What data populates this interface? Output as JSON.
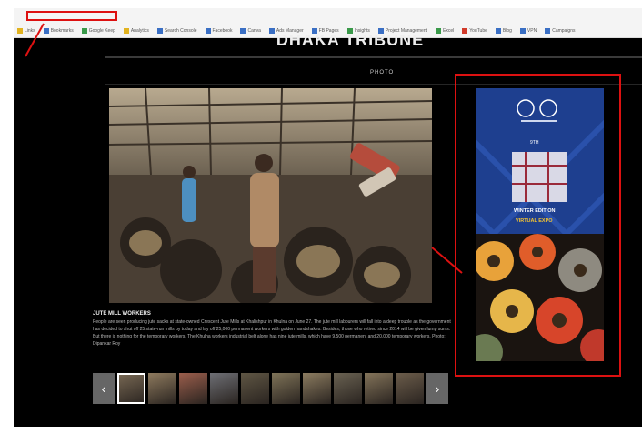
{
  "browser": {
    "bookmarks": [
      {
        "icon": "folder-icon",
        "label": "Links",
        "color": "y"
      },
      {
        "icon": "bookmark-icon",
        "label": "Bookmarks",
        "color": ""
      },
      {
        "icon": "bookmark-icon",
        "label": "Google Keep",
        "color": "g"
      },
      {
        "icon": "bookmark-icon",
        "label": "Analytics",
        "color": "y"
      },
      {
        "icon": "bookmark-icon",
        "label": "Search Console",
        "color": ""
      },
      {
        "icon": "bookmark-icon",
        "label": "Facebook",
        "color": ""
      },
      {
        "icon": "bookmark-icon",
        "label": "Canva",
        "color": ""
      },
      {
        "icon": "bookmark-icon",
        "label": "Ads Manager",
        "color": ""
      },
      {
        "icon": "bookmark-icon",
        "label": "FB Pages",
        "color": ""
      },
      {
        "icon": "bookmark-icon",
        "label": "Insights",
        "color": "g"
      },
      {
        "icon": "bookmark-icon",
        "label": "Project Management",
        "color": ""
      },
      {
        "icon": "bookmark-icon",
        "label": "Excel",
        "color": "g"
      },
      {
        "icon": "bookmark-icon",
        "label": "YouTube",
        "color": "r"
      },
      {
        "icon": "bookmark-icon",
        "label": "Blog",
        "color": ""
      },
      {
        "icon": "bookmark-icon",
        "label": "VPN",
        "color": ""
      },
      {
        "icon": "bookmark-icon",
        "label": "Campaigns",
        "color": ""
      }
    ]
  },
  "site": {
    "title": "DHAKA TRIBUNE",
    "section": "PHOTO"
  },
  "photo": {
    "caption_title": "JUTE MILL WORKERS",
    "caption_text": "People are seen producing jute sacks at state-owned Crescent Jute Mills at Khalishpur in Khulna on June 27. The jute mill labourers will fall into a deep trouble as the government has decided to shut off 25 state-run mills by today and lay off 25,000 permanent workers with golden handshakes. Besides, those who retired since 2014 will be given lump sums. But there is nothing for the temporary workers. The Khulna workers industrial belt alone has nine jute mills, which have 9,500 permanent and 20,000 temporary workers. Photo: Dipankar Roy"
  },
  "gallery": {
    "prev_label": "‹",
    "next_label": "›",
    "thumbnails": [
      {
        "label": "thumbnail 1",
        "selected": true
      },
      {
        "label": "thumbnail 2",
        "selected": false
      },
      {
        "label": "thumbnail 3",
        "selected": false
      },
      {
        "label": "thumbnail 4",
        "selected": false
      },
      {
        "label": "thumbnail 5",
        "selected": false
      },
      {
        "label": "thumbnail 6",
        "selected": false
      },
      {
        "label": "thumbnail 7",
        "selected": false
      },
      {
        "label": "thumbnail 8",
        "selected": false
      },
      {
        "label": "thumbnail 9",
        "selected": false
      },
      {
        "label": "thumbnail 10",
        "selected": false
      }
    ]
  },
  "ad": {
    "line1": "9TH",
    "line2": "WINTER EDITION",
    "line3": "VIRTUAL EXPO"
  },
  "colors": {
    "highlight": "#dd1111",
    "page_bg": "#000000",
    "ad_blue": "#1e3f8f"
  }
}
